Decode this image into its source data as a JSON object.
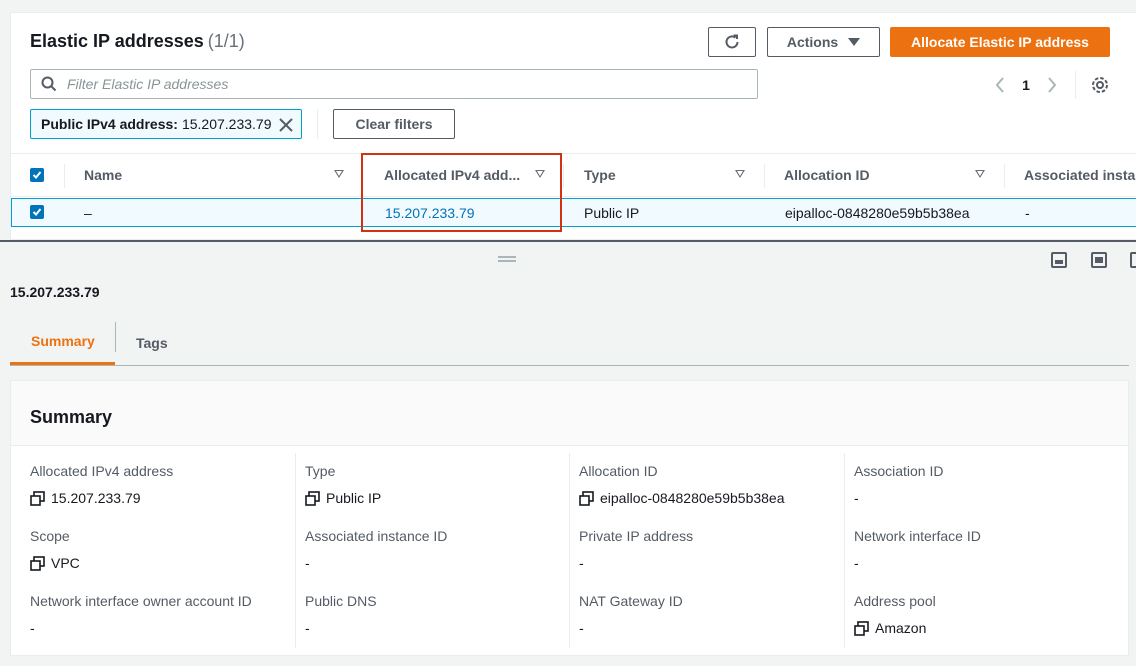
{
  "header": {
    "title": "Elastic IP addresses",
    "count": "(1/1)",
    "actions_label": "Actions",
    "allocate_label": "Allocate Elastic IP address"
  },
  "search": {
    "placeholder": "Filter Elastic IP addresses",
    "value": ""
  },
  "pagination": {
    "current_page": "1"
  },
  "filter": {
    "token_key": "Public IPv4 address:",
    "token_value": "15.207.233.79",
    "clear_label": "Clear filters"
  },
  "table": {
    "columns": [
      "Name",
      "Allocated IPv4 add...",
      "Type",
      "Allocation ID",
      "Associated insta"
    ],
    "rows": [
      {
        "name": "–",
        "ipv4": "15.207.233.79",
        "type": "Public IP",
        "allocation_id": "eipalloc-0848280e59b5b38ea",
        "associated_instance": "-"
      }
    ]
  },
  "details": {
    "title": "15.207.233.79",
    "tabs": [
      "Summary",
      "Tags"
    ],
    "active_tab": "Summary",
    "summary_heading": "Summary",
    "fields": [
      {
        "label": "Allocated IPv4 address",
        "value": "15.207.233.79",
        "copyable": true
      },
      {
        "label": "Type",
        "value": "Public IP",
        "copyable": true
      },
      {
        "label": "Allocation ID",
        "value": "eipalloc-0848280e59b5b38ea",
        "copyable": true
      },
      {
        "label": "Association ID",
        "value": "-",
        "copyable": false
      },
      {
        "label": "Scope",
        "value": "VPC",
        "copyable": true
      },
      {
        "label": "Associated instance ID",
        "value": "-",
        "copyable": false
      },
      {
        "label": "Private IP address",
        "value": "-",
        "copyable": false
      },
      {
        "label": "Network interface ID",
        "value": "-",
        "copyable": false
      },
      {
        "label": "Network interface owner account ID",
        "value": "-",
        "copyable": false
      },
      {
        "label": "Public DNS",
        "value": "-",
        "copyable": false
      },
      {
        "label": "NAT Gateway ID",
        "value": "-",
        "copyable": false
      },
      {
        "label": "Address pool",
        "value": "Amazon",
        "copyable": true
      }
    ]
  },
  "colors": {
    "primary": "#ec7211",
    "link": "#0073bb",
    "selection_border": "#00a1c9",
    "highlight_box": "#d13212"
  }
}
